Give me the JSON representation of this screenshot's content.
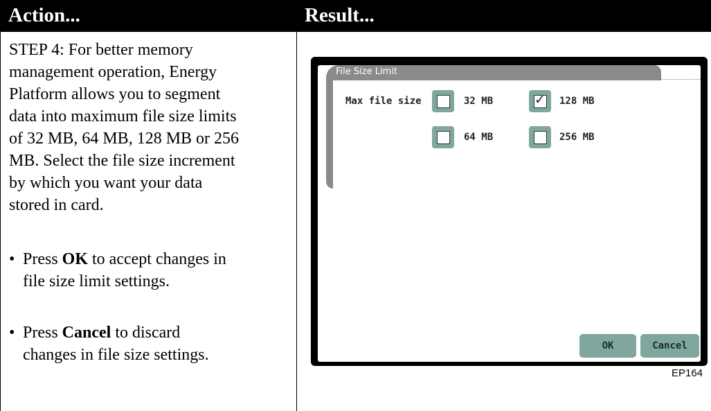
{
  "header": {
    "action": "Action...",
    "result": "Result..."
  },
  "action": {
    "step_lines": [
      "STEP 4: For better memory",
      "management operation, Energy",
      "Platform allows you to segment",
      "data into maximum file size limits",
      "of 32 MB, 64 MB, 128 MB or 256",
      "MB. Select the file size increment",
      "by which you want your data",
      "stored in card."
    ],
    "bullets": [
      {
        "prefix": "Press ",
        "bold": "OK",
        "suffix": " to accept changes in",
        "line2": "file size limit settings."
      },
      {
        "prefix": "Press ",
        "bold": "Cancel",
        "suffix": " to discard",
        "line2": "changes in file size settings."
      }
    ],
    "bullet_glyph": "•"
  },
  "dialog": {
    "title": "File Size Limit",
    "label": "Max file size",
    "options": [
      {
        "label": "32 MB",
        "checked": false
      },
      {
        "label": "128 MB",
        "checked": true
      },
      {
        "label": "64 MB",
        "checked": false
      },
      {
        "label": "256 MB",
        "checked": false
      }
    ],
    "check_glyph": "✓",
    "ok_label": "OK",
    "cancel_label": "Cancel"
  },
  "figure_id": "EP164"
}
